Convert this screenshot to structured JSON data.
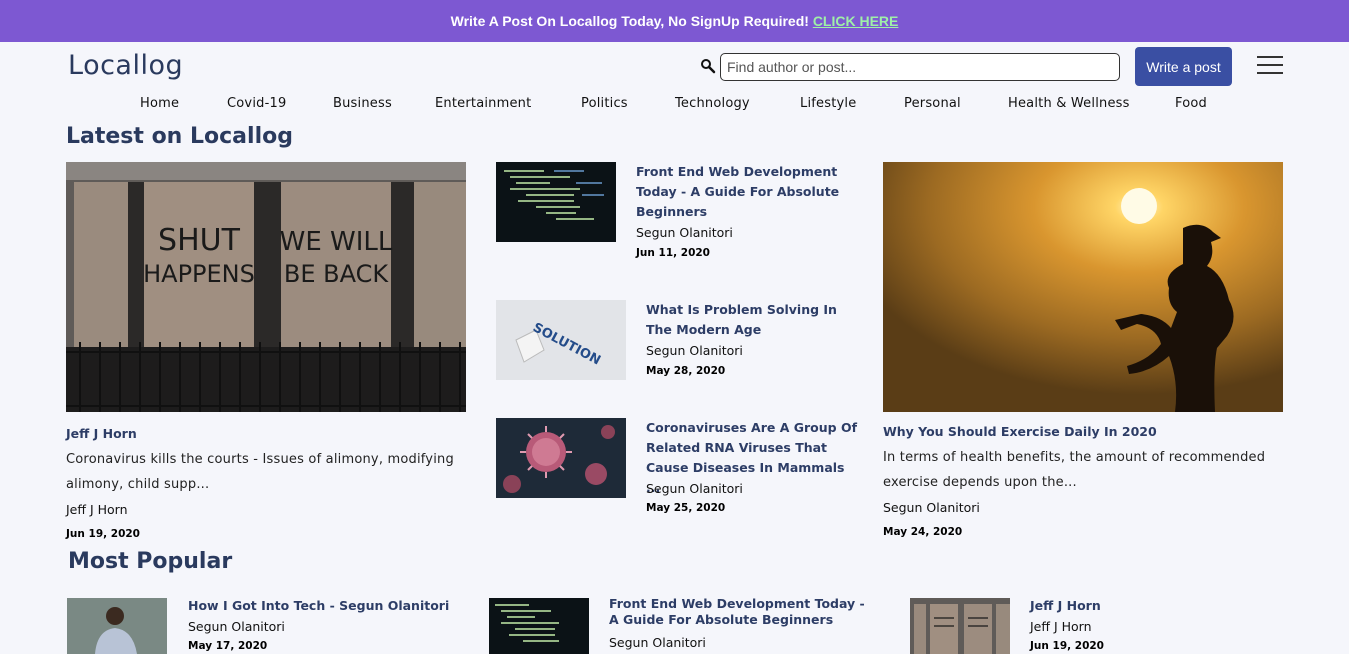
{
  "banner": {
    "text": "Write A Post On Locallog Today, No SignUp Required! ",
    "link": "CLICK HERE"
  },
  "header": {
    "logo": "Locallog",
    "search_placeholder": "Find author or post...",
    "write_label": "Write a post"
  },
  "nav": [
    "Home",
    "Covid-19",
    "Business",
    "Entertainment",
    "Politics",
    "Technology",
    "Lifestyle",
    "Personal",
    "Health & Wellness",
    "Food"
  ],
  "latest": {
    "heading": "Latest on Locallog",
    "left": {
      "title": "Jeff J Horn",
      "excerpt": "Coronavirus kills the courts - Issues of alimony, modifying alimony, child supp...",
      "author": "Jeff J Horn",
      "date": "Jun 19, 2020",
      "image_text": [
        "SHUT",
        "HAPPENS",
        "WE WILL",
        "BE BACK"
      ]
    },
    "middle": [
      {
        "title": "Front End Web Development Today - A Guide For Absolute Beginners",
        "author": "Segun Olanitori",
        "date": "Jun 11, 2020"
      },
      {
        "title": "What Is Problem Solving In The Modern Age",
        "author": "Segun Olanitori",
        "date": "May 28, 2020",
        "image_text": "SOLUTION"
      },
      {
        "title": "Coronaviruses Are A Group Of Related RNA Viruses That Cause Diseases In Mammals ...",
        "author": "Segun Olanitori",
        "date": "May 25, 2020"
      }
    ],
    "right": {
      "title": "Why You Should Exercise Daily In 2020",
      "excerpt": "In terms of health benefits, the amount of recommended exercise depends upon the...",
      "author": "Segun Olanitori",
      "date": "May 24, 2020"
    }
  },
  "popular": {
    "heading": "Most Popular",
    "items": [
      {
        "title": "How I Got Into Tech - Segun Olanitori",
        "author": "Segun Olanitori",
        "date": "May 17, 2020"
      },
      {
        "title": "Front End Web Development Today - A Guide For Absolute Beginners",
        "author": "Segun Olanitori"
      },
      {
        "title": "Jeff J Horn",
        "author": "Jeff J Horn",
        "date": "Jun 19, 2020"
      }
    ]
  },
  "colors": {
    "banner": "#7d58d2",
    "button": "#3a4fa3",
    "title": "#2d3d66"
  }
}
